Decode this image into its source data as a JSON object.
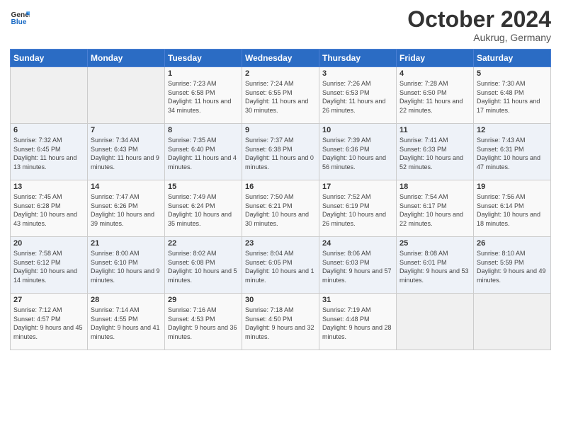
{
  "header": {
    "title": "October 2024",
    "location": "Aukrug, Germany"
  },
  "days": [
    "Sunday",
    "Monday",
    "Tuesday",
    "Wednesday",
    "Thursday",
    "Friday",
    "Saturday"
  ],
  "weeks": [
    [
      {
        "day": null
      },
      {
        "day": null
      },
      {
        "day": 1,
        "sunrise": "Sunrise: 7:23 AM",
        "sunset": "Sunset: 6:58 PM",
        "daylight": "Daylight: 11 hours and 34 minutes."
      },
      {
        "day": 2,
        "sunrise": "Sunrise: 7:24 AM",
        "sunset": "Sunset: 6:55 PM",
        "daylight": "Daylight: 11 hours and 30 minutes."
      },
      {
        "day": 3,
        "sunrise": "Sunrise: 7:26 AM",
        "sunset": "Sunset: 6:53 PM",
        "daylight": "Daylight: 11 hours and 26 minutes."
      },
      {
        "day": 4,
        "sunrise": "Sunrise: 7:28 AM",
        "sunset": "Sunset: 6:50 PM",
        "daylight": "Daylight: 11 hours and 22 minutes."
      },
      {
        "day": 5,
        "sunrise": "Sunrise: 7:30 AM",
        "sunset": "Sunset: 6:48 PM",
        "daylight": "Daylight: 11 hours and 17 minutes."
      }
    ],
    [
      {
        "day": 6,
        "sunrise": "Sunrise: 7:32 AM",
        "sunset": "Sunset: 6:45 PM",
        "daylight": "Daylight: 11 hours and 13 minutes."
      },
      {
        "day": 7,
        "sunrise": "Sunrise: 7:34 AM",
        "sunset": "Sunset: 6:43 PM",
        "daylight": "Daylight: 11 hours and 9 minutes."
      },
      {
        "day": 8,
        "sunrise": "Sunrise: 7:35 AM",
        "sunset": "Sunset: 6:40 PM",
        "daylight": "Daylight: 11 hours and 4 minutes."
      },
      {
        "day": 9,
        "sunrise": "Sunrise: 7:37 AM",
        "sunset": "Sunset: 6:38 PM",
        "daylight": "Daylight: 11 hours and 0 minutes."
      },
      {
        "day": 10,
        "sunrise": "Sunrise: 7:39 AM",
        "sunset": "Sunset: 6:36 PM",
        "daylight": "Daylight: 10 hours and 56 minutes."
      },
      {
        "day": 11,
        "sunrise": "Sunrise: 7:41 AM",
        "sunset": "Sunset: 6:33 PM",
        "daylight": "Daylight: 10 hours and 52 minutes."
      },
      {
        "day": 12,
        "sunrise": "Sunrise: 7:43 AM",
        "sunset": "Sunset: 6:31 PM",
        "daylight": "Daylight: 10 hours and 47 minutes."
      }
    ],
    [
      {
        "day": 13,
        "sunrise": "Sunrise: 7:45 AM",
        "sunset": "Sunset: 6:28 PM",
        "daylight": "Daylight: 10 hours and 43 minutes."
      },
      {
        "day": 14,
        "sunrise": "Sunrise: 7:47 AM",
        "sunset": "Sunset: 6:26 PM",
        "daylight": "Daylight: 10 hours and 39 minutes."
      },
      {
        "day": 15,
        "sunrise": "Sunrise: 7:49 AM",
        "sunset": "Sunset: 6:24 PM",
        "daylight": "Daylight: 10 hours and 35 minutes."
      },
      {
        "day": 16,
        "sunrise": "Sunrise: 7:50 AM",
        "sunset": "Sunset: 6:21 PM",
        "daylight": "Daylight: 10 hours and 30 minutes."
      },
      {
        "day": 17,
        "sunrise": "Sunrise: 7:52 AM",
        "sunset": "Sunset: 6:19 PM",
        "daylight": "Daylight: 10 hours and 26 minutes."
      },
      {
        "day": 18,
        "sunrise": "Sunrise: 7:54 AM",
        "sunset": "Sunset: 6:17 PM",
        "daylight": "Daylight: 10 hours and 22 minutes."
      },
      {
        "day": 19,
        "sunrise": "Sunrise: 7:56 AM",
        "sunset": "Sunset: 6:14 PM",
        "daylight": "Daylight: 10 hours and 18 minutes."
      }
    ],
    [
      {
        "day": 20,
        "sunrise": "Sunrise: 7:58 AM",
        "sunset": "Sunset: 6:12 PM",
        "daylight": "Daylight: 10 hours and 14 minutes."
      },
      {
        "day": 21,
        "sunrise": "Sunrise: 8:00 AM",
        "sunset": "Sunset: 6:10 PM",
        "daylight": "Daylight: 10 hours and 9 minutes."
      },
      {
        "day": 22,
        "sunrise": "Sunrise: 8:02 AM",
        "sunset": "Sunset: 6:08 PM",
        "daylight": "Daylight: 10 hours and 5 minutes."
      },
      {
        "day": 23,
        "sunrise": "Sunrise: 8:04 AM",
        "sunset": "Sunset: 6:05 PM",
        "daylight": "Daylight: 10 hours and 1 minute."
      },
      {
        "day": 24,
        "sunrise": "Sunrise: 8:06 AM",
        "sunset": "Sunset: 6:03 PM",
        "daylight": "Daylight: 9 hours and 57 minutes."
      },
      {
        "day": 25,
        "sunrise": "Sunrise: 8:08 AM",
        "sunset": "Sunset: 6:01 PM",
        "daylight": "Daylight: 9 hours and 53 minutes."
      },
      {
        "day": 26,
        "sunrise": "Sunrise: 8:10 AM",
        "sunset": "Sunset: 5:59 PM",
        "daylight": "Daylight: 9 hours and 49 minutes."
      }
    ],
    [
      {
        "day": 27,
        "sunrise": "Sunrise: 7:12 AM",
        "sunset": "Sunset: 4:57 PM",
        "daylight": "Daylight: 9 hours and 45 minutes."
      },
      {
        "day": 28,
        "sunrise": "Sunrise: 7:14 AM",
        "sunset": "Sunset: 4:55 PM",
        "daylight": "Daylight: 9 hours and 41 minutes."
      },
      {
        "day": 29,
        "sunrise": "Sunrise: 7:16 AM",
        "sunset": "Sunset: 4:53 PM",
        "daylight": "Daylight: 9 hours and 36 minutes."
      },
      {
        "day": 30,
        "sunrise": "Sunrise: 7:18 AM",
        "sunset": "Sunset: 4:50 PM",
        "daylight": "Daylight: 9 hours and 32 minutes."
      },
      {
        "day": 31,
        "sunrise": "Sunrise: 7:19 AM",
        "sunset": "Sunset: 4:48 PM",
        "daylight": "Daylight: 9 hours and 28 minutes."
      },
      {
        "day": null
      },
      {
        "day": null
      }
    ]
  ]
}
